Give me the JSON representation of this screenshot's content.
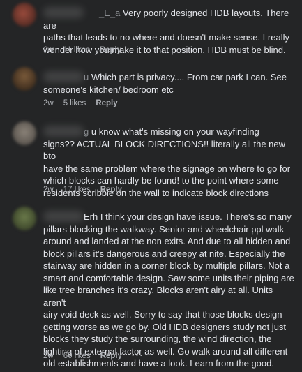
{
  "comments": [
    {
      "name_suffix": "_E_a",
      "text_lines": [
        "Very poorly designed HDB layouts. There are",
        "paths that leads to no where and doesn't make sense. I really",
        "wonder how you make it to that position. HDB must be blind."
      ],
      "time": "2w",
      "likes": "11 likes",
      "reply": "Reply"
    },
    {
      "name_suffix": "u",
      "text_lines": [
        "Which part is privacy.... From car park I can. See",
        "someone's kitchen/ bedroom etc"
      ],
      "time": "2w",
      "likes": "5 likes",
      "reply": "Reply"
    },
    {
      "name_suffix": "g",
      "text_lines": [
        "u know what's missing on your wayfinding",
        "signs?? ACTUAL BLOCK DIRECTIONS!! literally all the new bto",
        "have the same problem where the signage on where to go for",
        "which blocks can hardly be found! to the point where some",
        "residents scribble on the wall to indicate block directions"
      ],
      "time": "2w",
      "likes": "17 likes",
      "reply": "Reply"
    },
    {
      "name_suffix": "",
      "text_lines": [
        "Erh I think your design have issue. There's so many",
        "pillars blocking the walkway. Senior and wheelchair ppl walk",
        "around and landed at the non exits. And due to all hidden and",
        "block pillars it's dangerous and creepy at nite. Especially the",
        "stairway are hidden in a corner block by multiple pillars. Not a",
        "smart and comfortable design. Saw some units their piping are",
        "like tree branches it's crazy. Blocks aren't airy at all. Units aren't",
        "airy void deck as well. Sorry to say that those blocks design",
        "getting worse as we go by. Old HDB designers study not just",
        "blocks they study the surrounding, the wind direction, the",
        "lighting of external factor as well. Go walk around all different",
        "old establishments and have a look. Learn from the good."
      ],
      "time": "2w",
      "likes": "60 likes",
      "reply": "Reply",
      "more": "···"
    }
  ],
  "colors": {
    "background": "#242526",
    "text": "#e4e6eb",
    "meta": "#b0b3b8"
  }
}
